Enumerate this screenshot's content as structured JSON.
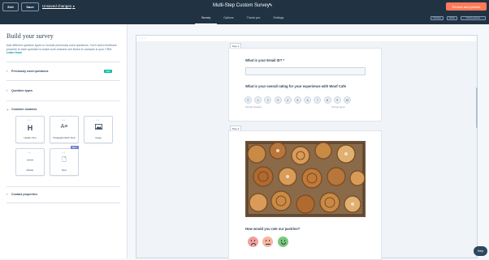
{
  "header": {
    "exit_label": "Exit",
    "save_label": "Save",
    "unsaved_label": "Unsaved changes",
    "title": "Multi-Step Custom Survey",
    "tabs": [
      "Survey",
      "Options",
      "Thank you",
      "Settings"
    ],
    "review_label": "Review and publish",
    "preview_label": "Preview",
    "share_label": "Share",
    "actions_label": "Survey actions",
    "accent_color": "#ff7a59"
  },
  "sidebar": {
    "title": "Build your survey",
    "description": "Add different question types or include previously used questions. You'll add a feedback property to each question to make sure answers are linked to contacts in your CRM.",
    "learn_more": "Learn more",
    "sections": [
      {
        "label": "Previously used questions",
        "badge": "NEW"
      },
      {
        "label": "Question types"
      },
      {
        "label": "Common modules"
      },
      {
        "label": "Contact properties"
      }
    ],
    "modules": [
      {
        "label": "Header Text",
        "icon": "heading-icon"
      },
      {
        "label": "Paragraph (Rich Text)",
        "icon": "rich-text-icon"
      },
      {
        "label": "Image",
        "icon": "image-icon"
      },
      {
        "label": "Divider",
        "icon": "divider-icon"
      },
      {
        "label": "Next",
        "icon": "next-page-icon",
        "badge": "BETA"
      }
    ]
  },
  "form": {
    "step1_label": "Step 1",
    "step2_label": "Step 2",
    "q_email": "What is your Email ID? *",
    "q_rating": "What is your overall rating for your experience with Woof Cafe",
    "nps_values": [
      "0",
      "1",
      "2",
      "3",
      "4",
      "5",
      "6",
      "7",
      "8",
      "9",
      "10"
    ],
    "nps_low": "Strongly disagree",
    "nps_high": "Strongly agree",
    "q_pastries": "How would you rate our pastries?"
  },
  "help_label": "Help"
}
